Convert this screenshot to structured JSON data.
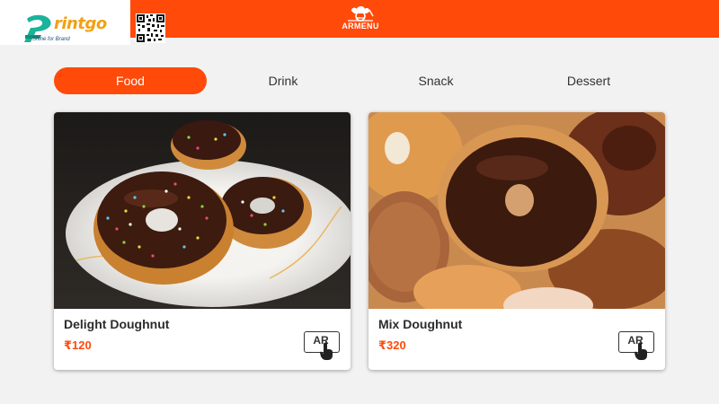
{
  "header": {
    "brand_name": "rintgo",
    "brand_tagline": "Shine for Brand",
    "center_logo_text": "ARMENU",
    "colors": {
      "accent": "#ff4a0a",
      "brand_teal": "#1bb39a",
      "brand_gold": "#f2a013"
    },
    "icons": [
      "printgo-logo-icon",
      "qr-code-icon",
      "chef-platter-icon"
    ]
  },
  "tabs": [
    {
      "label": "Food",
      "active": true
    },
    {
      "label": "Drink",
      "active": false
    },
    {
      "label": "Snack",
      "active": false
    },
    {
      "label": "Dessert",
      "active": false
    }
  ],
  "items": [
    {
      "name": "Delight Doughnut",
      "price": "₹120",
      "ar_label": "AR",
      "image": "chocolate-sprinkle-doughnuts-photo"
    },
    {
      "name": "Mix Doughnut",
      "price": "₹320",
      "ar_label": "AR",
      "image": "assorted-doughnuts-photo"
    }
  ]
}
